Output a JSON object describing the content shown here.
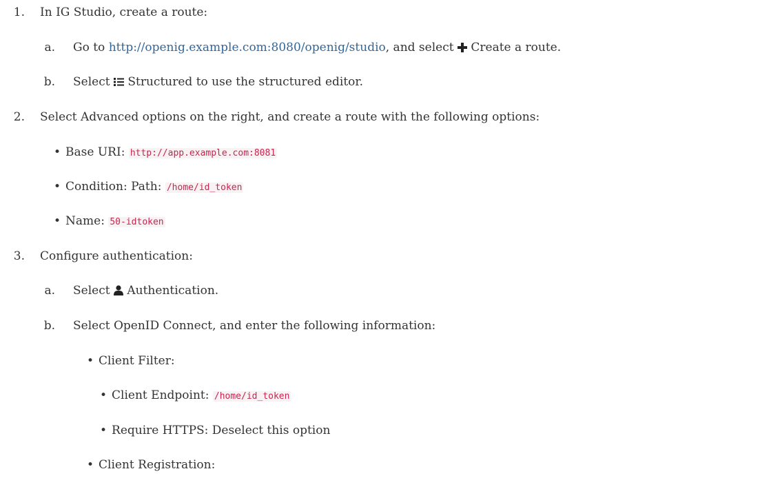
{
  "steps": [
    {
      "marker": "1.",
      "text": "In IG Studio, create a route:",
      "substeps": [
        {
          "marker": "a.",
          "pre": "Go to ",
          "link": "http://openig.example.com:8080/openig/studio",
          "mid": ", and select ",
          "icon": "plus-icon",
          "post": "Create a route."
        },
        {
          "marker": "b.",
          "pre": "Select ",
          "icon": "list-icon",
          "post": "Structured to use the structured editor."
        }
      ]
    },
    {
      "marker": "2.",
      "text": "Select Advanced options on the right, and create a route with the following options:",
      "bullets": [
        {
          "label": "Base URI: ",
          "code": "http://app.example.com:8081"
        },
        {
          "label": "Condition: Path: ",
          "code": "/home/id_token"
        },
        {
          "label": "Name: ",
          "code": "50-idtoken"
        }
      ]
    },
    {
      "marker": "3.",
      "text": "Configure authentication:",
      "substeps": [
        {
          "marker": "a.",
          "pre": "Select ",
          "icon": "user-icon",
          "post": "Authentication."
        },
        {
          "marker": "b.",
          "text": "Select OpenID Connect, and enter the following information:",
          "bullets": [
            {
              "label": "Client Filter:",
              "children": [
                {
                  "label": "Client Endpoint: ",
                  "code": "/home/id_token"
                },
                {
                  "label": "Require HTTPS: Deselect this option"
                }
              ]
            },
            {
              "label": "Client Registration:"
            }
          ]
        }
      ]
    }
  ],
  "bullet_char": "•"
}
